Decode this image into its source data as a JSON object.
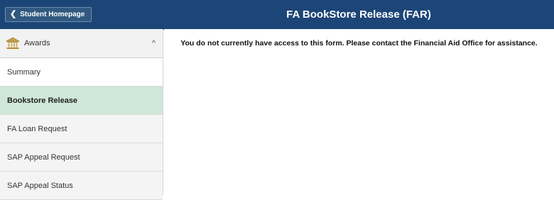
{
  "header": {
    "back_label": "Student Homepage",
    "title": "FA BookStore Release (FAR)"
  },
  "sidebar": {
    "group": {
      "label": "Awards",
      "icon": "bank-building-icon",
      "expanded": true
    },
    "items": [
      {
        "label": "Summary",
        "active": false
      },
      {
        "label": "Bookstore Release",
        "active": true
      },
      {
        "label": "FA Loan Request",
        "active": false
      },
      {
        "label": "SAP Appeal Request",
        "active": false
      },
      {
        "label": "SAP Appeal Status",
        "active": false
      }
    ]
  },
  "main": {
    "message": "You do not currently have access to this form. Please contact the Financial Aid Office for assistance."
  },
  "colors": {
    "header_bg": "#1d4678",
    "active_item_bg": "#cfe7d8",
    "sidebar_bg": "#f2f2f2"
  }
}
